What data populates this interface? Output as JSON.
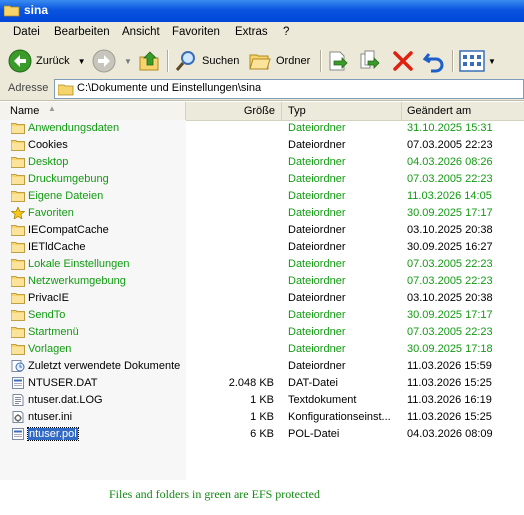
{
  "window": {
    "title": "sina"
  },
  "menu": [
    "Datei",
    "Bearbeiten",
    "Ansicht",
    "Favoriten",
    "Extras",
    "?"
  ],
  "toolbar": {
    "back_label": "Zurück",
    "search_label": "Suchen",
    "folders_label": "Ordner"
  },
  "address": {
    "label": "Adresse",
    "path": "C:\\Dokumente und Einstellungen\\sina"
  },
  "columns": {
    "name": "Name",
    "size": "Größe",
    "type": "Typ",
    "modified": "Geändert am"
  },
  "files": [
    {
      "name": "Anwendungsdaten",
      "size": "",
      "type": "Dateiordner",
      "modified": "31.10.2025 15:31",
      "green": true,
      "icon": "folder-icon"
    },
    {
      "name": "Cookies",
      "size": "",
      "type": "Dateiordner",
      "modified": "07.03.2005 22:23",
      "green": false,
      "icon": "folder-icon"
    },
    {
      "name": "Desktop",
      "size": "",
      "type": "Dateiordner",
      "modified": "04.03.2026 08:26",
      "green": true,
      "icon": "folder-icon"
    },
    {
      "name": "Druckumgebung",
      "size": "",
      "type": "Dateiordner",
      "modified": "07.03.2005 22:23",
      "green": true,
      "icon": "folder-icon"
    },
    {
      "name": "Eigene Dateien",
      "size": "",
      "type": "Dateiordner",
      "modified": "11.03.2026 14:05",
      "green": true,
      "icon": "folder-icon"
    },
    {
      "name": "Favoriten",
      "size": "",
      "type": "Dateiordner",
      "modified": "30.09.2025 17:17",
      "green": true,
      "icon": "star-folder-icon"
    },
    {
      "name": "IECompatCache",
      "size": "",
      "type": "Dateiordner",
      "modified": "03.10.2025 20:38",
      "green": false,
      "icon": "folder-icon"
    },
    {
      "name": "IETldCache",
      "size": "",
      "type": "Dateiordner",
      "modified": "30.09.2025 16:27",
      "green": false,
      "icon": "folder-icon"
    },
    {
      "name": "Lokale Einstellungen",
      "size": "",
      "type": "Dateiordner",
      "modified": "07.03.2005 22:23",
      "green": true,
      "icon": "folder-icon"
    },
    {
      "name": "Netzwerkumgebung",
      "size": "",
      "type": "Dateiordner",
      "modified": "07.03.2005 22:23",
      "green": true,
      "icon": "folder-icon"
    },
    {
      "name": "PrivacIE",
      "size": "",
      "type": "Dateiordner",
      "modified": "03.10.2025 20:38",
      "green": false,
      "icon": "folder-icon"
    },
    {
      "name": "SendTo",
      "size": "",
      "type": "Dateiordner",
      "modified": "30.09.2025 17:17",
      "green": true,
      "icon": "folder-icon"
    },
    {
      "name": "Startmenü",
      "size": "",
      "type": "Dateiordner",
      "modified": "07.03.2005 22:23",
      "green": true,
      "icon": "folder-icon"
    },
    {
      "name": "Vorlagen",
      "size": "",
      "type": "Dateiordner",
      "modified": "30.09.2025 17:18",
      "green": true,
      "icon": "folder-icon"
    },
    {
      "name": "Zuletzt verwendete Dokumente",
      "size": "",
      "type": "Dateiordner",
      "modified": "11.03.2026 15:59",
      "green": false,
      "icon": "recent-docs-icon"
    },
    {
      "name": "NTUSER.DAT",
      "size": "2.048 KB",
      "type": "DAT-Datei",
      "modified": "11.03.2026 15:25",
      "green": false,
      "icon": "file-icon"
    },
    {
      "name": "ntuser.dat.LOG",
      "size": "1 KB",
      "type": "Textdokument",
      "modified": "11.03.2026 16:19",
      "green": false,
      "icon": "text-file-icon"
    },
    {
      "name": "ntuser.ini",
      "size": "1 KB",
      "type": "Konfigurationseinst...",
      "modified": "11.03.2026 15:25",
      "green": false,
      "icon": "ini-file-icon"
    },
    {
      "name": "ntuser.pol",
      "size": "6 KB",
      "type": "POL-Datei",
      "modified": "04.03.2026 08:09",
      "green": false,
      "icon": "file-icon",
      "selected": true
    }
  ],
  "footer_note": "Files and folders in green are EFS protected",
  "colors": {
    "efs_green": "#129b12",
    "titlebar_blue": "#0a54e0",
    "selection": "#316ac5"
  }
}
